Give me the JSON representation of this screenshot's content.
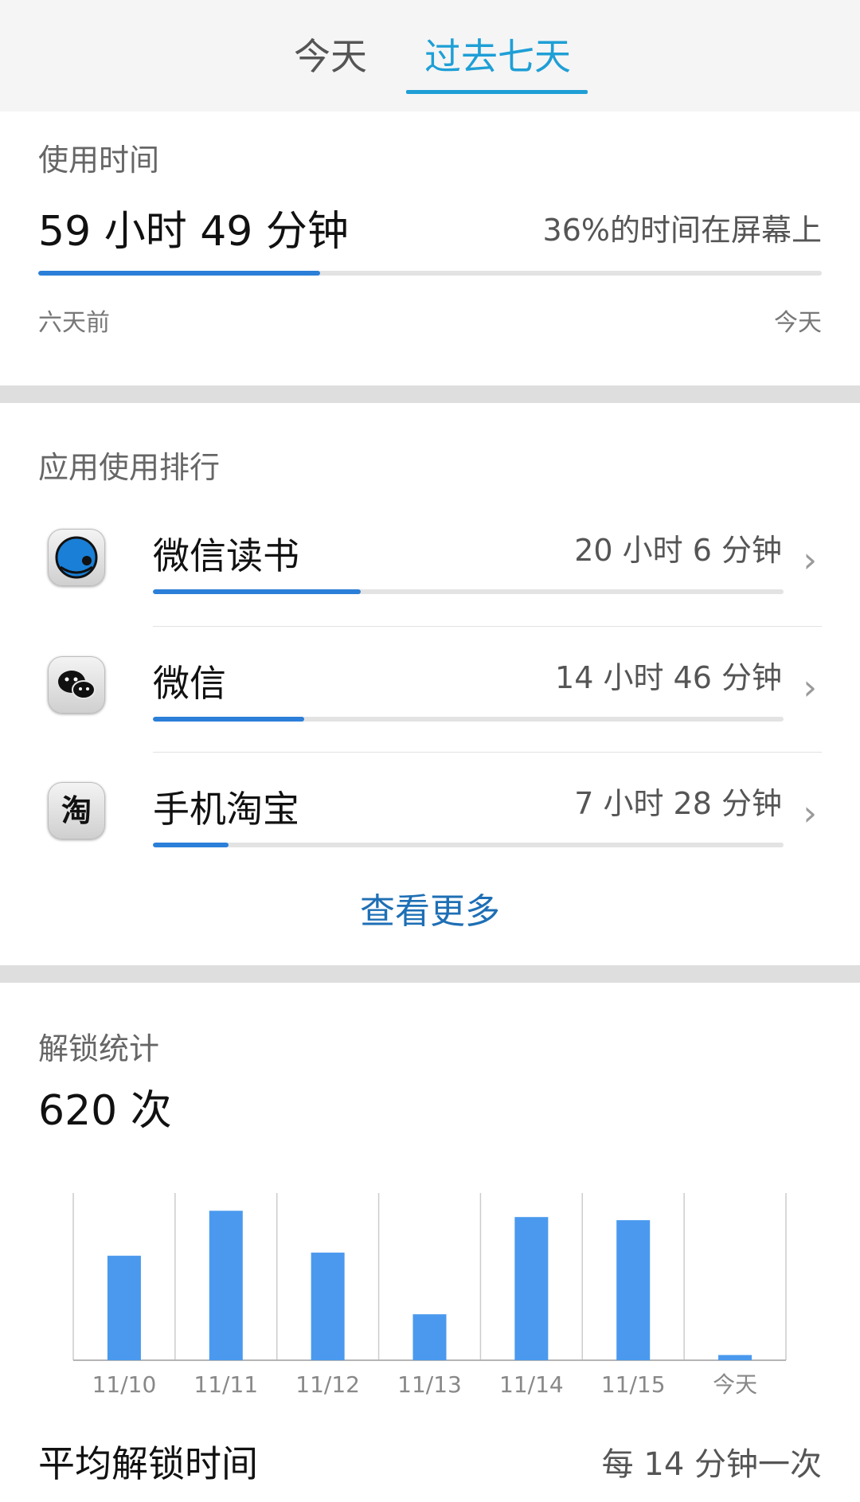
{
  "tabs": [
    {
      "label": "今天",
      "active": false
    },
    {
      "label": "过去七天",
      "active": true
    }
  ],
  "colors": {
    "accent": "#1e9fd6",
    "bar": "#4a99ee",
    "progress": "#2b7fd8"
  },
  "usage": {
    "title": "使用时间",
    "total": "59 小时 49 分钟",
    "ratio_text": "36%的时间在屏幕上",
    "progress": 0.36,
    "range_start": "六天前",
    "range_end": "今天"
  },
  "ranking": {
    "title": "应用使用排行",
    "apps": [
      {
        "name": "微信读书",
        "time": "20 小时 6 分钟",
        "share": 0.33,
        "icon": "weread-icon"
      },
      {
        "name": "微信",
        "time": "14 小时 46 分钟",
        "share": 0.24,
        "icon": "wechat-icon"
      },
      {
        "name": "手机淘宝",
        "time": "7 小时 28 分钟",
        "share": 0.12,
        "icon": "taobao-icon"
      }
    ],
    "see_more": "查看更多"
  },
  "unlock": {
    "title": "解锁统计",
    "count": "620 次",
    "avg_label": "平均解锁时间",
    "avg_value": "每 14 分钟一次"
  },
  "chart_data": {
    "type": "bar",
    "categories": [
      "11/10",
      "11/11",
      "11/12",
      "11/13",
      "11/14",
      "11/15",
      "今天"
    ],
    "values": [
      100,
      143,
      103,
      44,
      137,
      134,
      5
    ],
    "ylim": [
      0,
      160
    ],
    "grid": true
  }
}
